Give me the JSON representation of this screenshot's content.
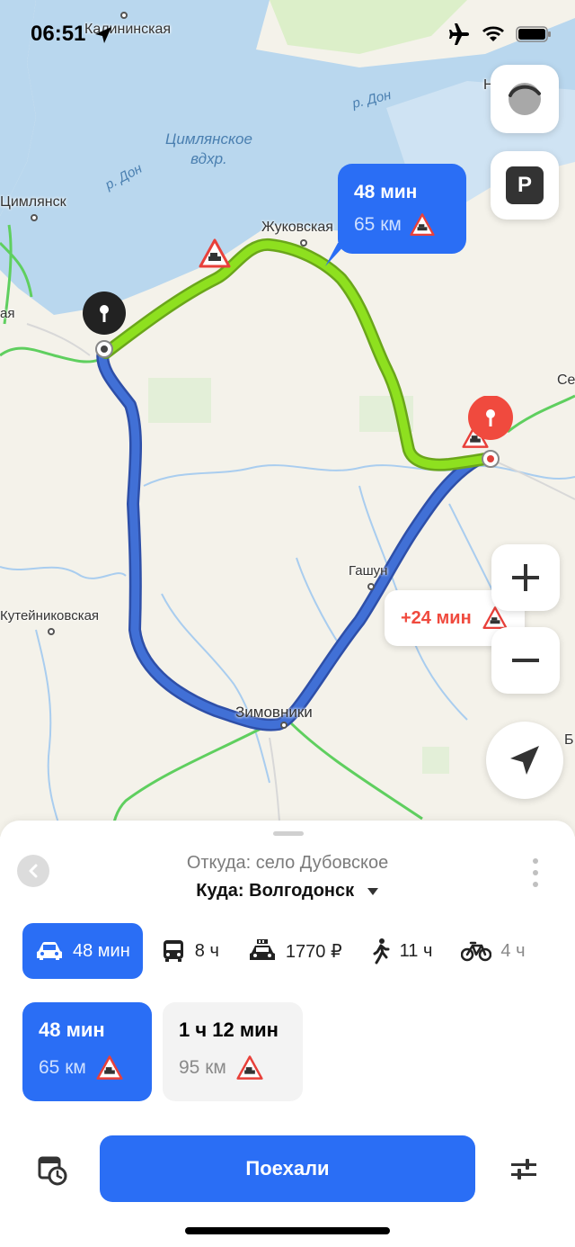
{
  "status": {
    "time": "06:51"
  },
  "map": {
    "labels": {
      "kalininskaya": "Калининская",
      "tsimlyansk": "Цимлянск",
      "aya": "ая",
      "zhukovskaya": "Жуковская",
      "gashun": "Гашун",
      "kuteynikovskaya": "Кутейниковская",
      "zimovniki": "Зимовники",
      "nikolaevskaya_partial": "Нико",
      "se_partial": "Се",
      "b_partial": "Б"
    },
    "water": {
      "reservoir_line1": "Цимлянское",
      "reservoir_line2": "вдхр.",
      "river1": "р. Дон",
      "river2": "р. Дон"
    },
    "route_callout": {
      "time": "48 мин",
      "distance": "65 км"
    },
    "alt_callout": {
      "delta": "+24 мин"
    },
    "buttons": {
      "parking": "P"
    },
    "colors": {
      "primary_route": "#8ee01f",
      "alt_route": "#3f6bd1",
      "accent": "#2a6ef5",
      "destination": "#f04a3e"
    }
  },
  "sheet": {
    "from": "Откуда: село Дубовское",
    "to": "Куда: Волгодонск",
    "modes": [
      {
        "icon": "car-icon",
        "label": "48 мин"
      },
      {
        "icon": "bus-icon",
        "label": "8 ч"
      },
      {
        "icon": "taxi-icon",
        "label": "1770 ₽"
      },
      {
        "icon": "walk-icon",
        "label": "11 ч"
      },
      {
        "icon": "bike-icon",
        "label": "4 ч"
      }
    ],
    "variants": [
      {
        "time": "48 мин",
        "distance": "65 км"
      },
      {
        "time": "1 ч 12 мин",
        "distance": "95 км"
      }
    ],
    "go_label": "Поехали"
  }
}
